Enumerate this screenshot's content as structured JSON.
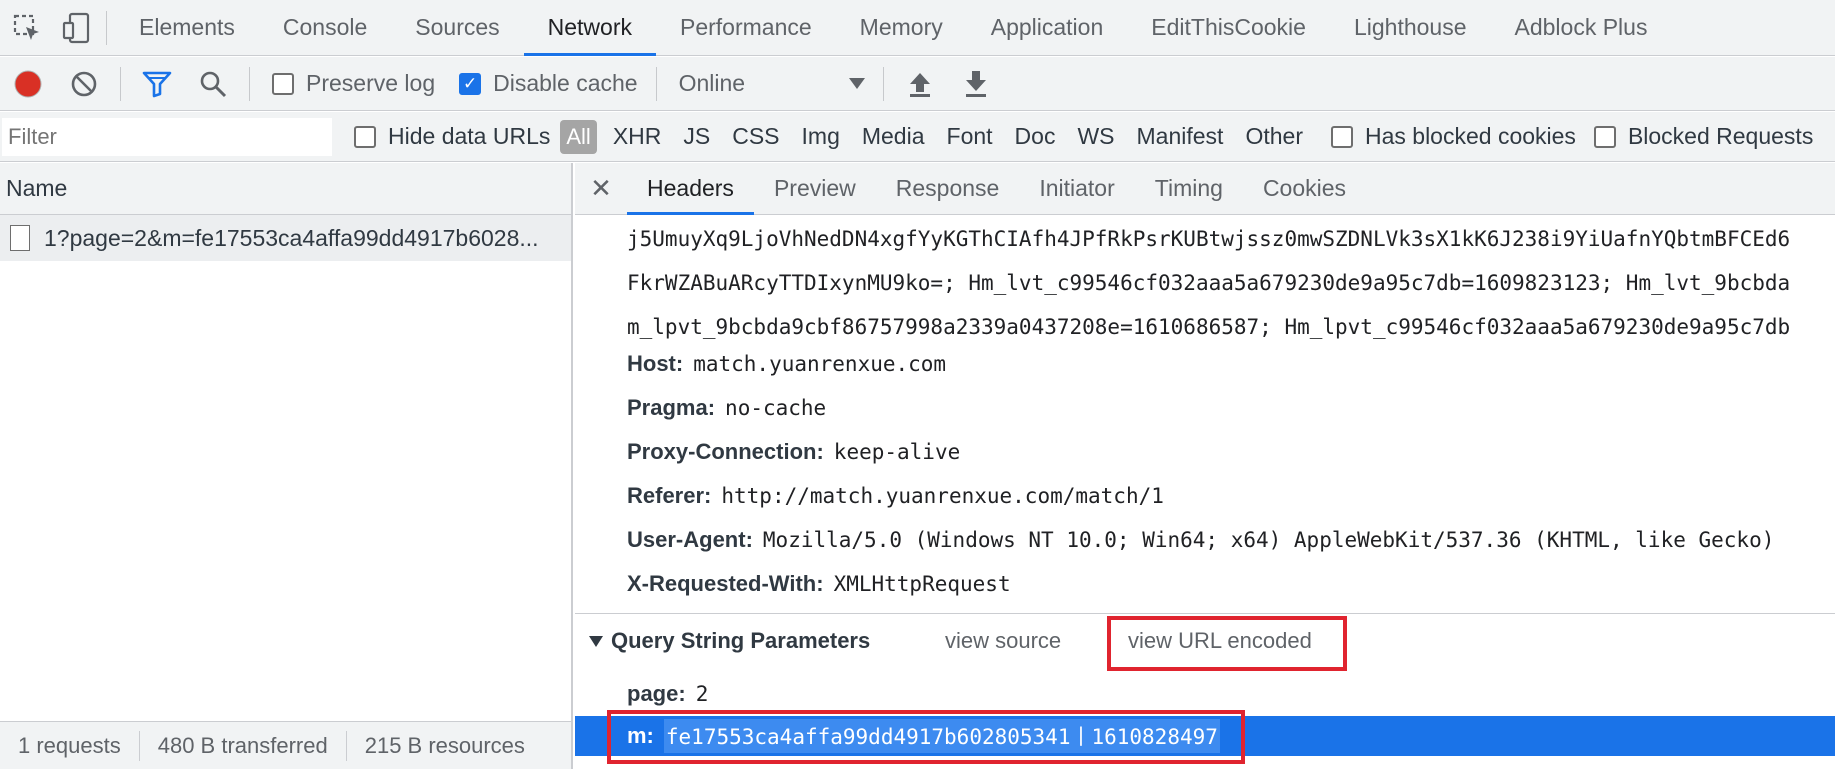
{
  "tabs": [
    "Elements",
    "Console",
    "Sources",
    "Network",
    "Performance",
    "Memory",
    "Application",
    "EditThisCookie",
    "Lighthouse",
    "Adblock Plus"
  ],
  "active_tab": "Network",
  "toolbar": {
    "preserve_log": "Preserve log",
    "disable_cache": "Disable cache",
    "throttle": "Online"
  },
  "filter": {
    "placeholder": "Filter",
    "hide_data_urls": "Hide data URLs",
    "all": "All",
    "types": [
      "XHR",
      "JS",
      "CSS",
      "Img",
      "Media",
      "Font",
      "Doc",
      "WS",
      "Manifest",
      "Other"
    ],
    "has_blocked_cookies": "Has blocked cookies",
    "blocked_requests": "Blocked Requests"
  },
  "left": {
    "column_header": "Name",
    "request_name": "1?page=2&m=fe17553ca4affa99dd4917b6028...",
    "status": {
      "requests": "1 requests",
      "transferred": "480 B transferred",
      "resources": "215 B resources"
    }
  },
  "detail_tabs": [
    "Headers",
    "Preview",
    "Response",
    "Initiator",
    "Timing",
    "Cookies"
  ],
  "active_detail_tab": "Headers",
  "cookie_lines": [
    "j5UmuyXq9LjoVhNedDN4xgfYyKGThCIAfh4JPfRkPsrKUBtwjssz0mwSZDNLVk3sX1kK6J238i9YiUafnYQbtmBFCEd6",
    "FkrWZABuARcyTTDIxynMU9ko=; Hm_lvt_c99546cf032aaa5a679230de9a95c7db=1609823123; Hm_lvt_9bcbda",
    "m_lpvt_9bcbda9cbf86757998a2339a0437208e=1610686587; Hm_lpvt_c99546cf032aaa5a679230de9a95c7db"
  ],
  "headers": [
    {
      "key": "Host:",
      "value": "match.yuanrenxue.com"
    },
    {
      "key": "Pragma:",
      "value": "no-cache"
    },
    {
      "key": "Proxy-Connection:",
      "value": "keep-alive"
    },
    {
      "key": "Referer:",
      "value": "http://match.yuanrenxue.com/match/1"
    },
    {
      "key": "User-Agent:",
      "value": "Mozilla/5.0 (Windows NT 10.0; Win64; x64) AppleWebKit/537.36 (KHTML, like Gecko)"
    },
    {
      "key": "X-Requested-With:",
      "value": "XMLHttpRequest"
    }
  ],
  "query_string": {
    "title": "Query String Parameters",
    "view_source": "view source",
    "view_url_encoded": "view URL encoded",
    "params": [
      {
        "key": "page:",
        "value": "2"
      },
      {
        "key": "m:",
        "value": "fe17553ca4affa99dd4917b602805341丨1610828497"
      }
    ]
  },
  "colors": {
    "accent": "#1a73e8",
    "record": "#d93025",
    "highlight_box": "#e0242f"
  }
}
